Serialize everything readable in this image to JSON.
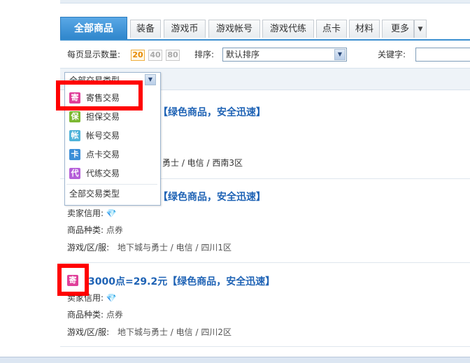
{
  "colors": {
    "accent": "#2f86cc",
    "title_link": "#1f63b5",
    "highlight": "#ff0000",
    "badge_ji": "#e0409a",
    "badge_bao": "#7cb832",
    "badge_zhang": "#4fb3d9",
    "badge_ka": "#3c8fd8",
    "badge_dai": "#b55fd9"
  },
  "tabs": [
    {
      "label": "全部商品",
      "active": true
    },
    {
      "label": "装备"
    },
    {
      "label": "游戏币"
    },
    {
      "label": "游戏帐号"
    },
    {
      "label": "游戏代练"
    },
    {
      "label": "点卡"
    },
    {
      "label": "材料"
    },
    {
      "label": "更多"
    }
  ],
  "filter": {
    "per_page_label": "每页显示数量:",
    "per_page_options": [
      "20",
      "40",
      "80"
    ],
    "per_page_selected": "20",
    "sort_label": "排序:",
    "sort_value": "默认排序",
    "keyword_label": "关键字:"
  },
  "trade_type": {
    "selected": "全部交易类型",
    "options": [
      {
        "badge": "寄",
        "label": "寄售交易",
        "icon": "consign-badge-icon"
      },
      {
        "badge": "保",
        "label": "担保交易",
        "icon": "guarantee-badge-icon"
      },
      {
        "badge": "帐",
        "label": "帐号交易",
        "icon": "account-badge-icon"
      },
      {
        "badge": "卡",
        "label": "点卡交易",
        "icon": "card-badge-icon"
      },
      {
        "badge": "代",
        "label": "代练交易",
        "icon": "leveling-badge-icon"
      }
    ],
    "all_label": "全部交易类型"
  },
  "listings": [
    {
      "title_visible": "【绿色商品，安全迅速】",
      "server_tail": "勇士 / 电信 / 西南3区"
    },
    {
      "title_visible": "【绿色商品，安全迅速】",
      "seller_label": "卖家信用:",
      "category_label": "商品种类:",
      "category_value": "点券",
      "server_label": "游戏/区/服:",
      "server_value": "地下城与勇士 / 电信 / 四川1区"
    },
    {
      "badge": "寄",
      "title_visible": "3000点=29.2元【绿色商品，安全迅速】",
      "seller_label": "卖家信用:",
      "category_label": "商品种类:",
      "category_value": "点券",
      "server_label": "游戏/区/服:",
      "server_value": "地下城与勇士 / 电信 / 四川2区"
    }
  ]
}
